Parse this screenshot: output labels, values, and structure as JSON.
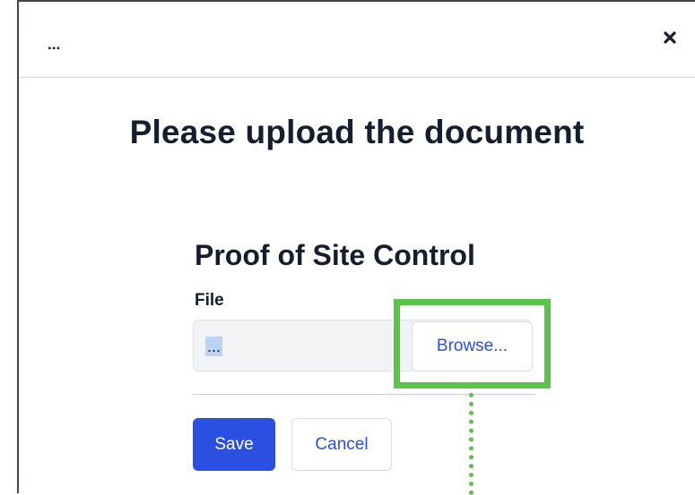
{
  "header": {
    "menu_label": "...",
    "close_icon": "close-icon"
  },
  "main": {
    "title": "Please upload the document",
    "section_title": "Proof of Site Control",
    "file_label": "File",
    "file_value": "...",
    "browse_label": "Browse...",
    "save_label": "Save",
    "cancel_label": "Cancel"
  },
  "colors": {
    "primary": "#2b4fe0",
    "link": "#2d4fd6",
    "highlight": "#5bc24a",
    "text": "#161d2e"
  }
}
